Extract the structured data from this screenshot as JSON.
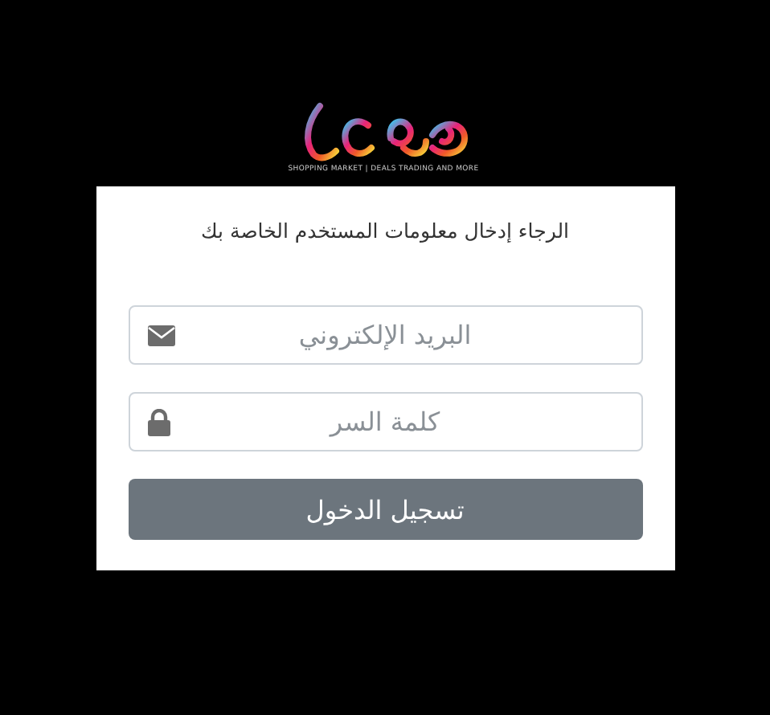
{
  "logo": {
    "tagline": "SHOPPING MARKET | DEALS TRADING AND MORE"
  },
  "login": {
    "prompt": "الرجاء إدخال معلومات المستخدم الخاصة بك",
    "fields": [
      {
        "kind": "email",
        "placeholder": "البريد الإلكتروني"
      },
      {
        "kind": "password",
        "placeholder": "كلمة السر"
      }
    ],
    "submit": "تسجيل الدخول"
  }
}
